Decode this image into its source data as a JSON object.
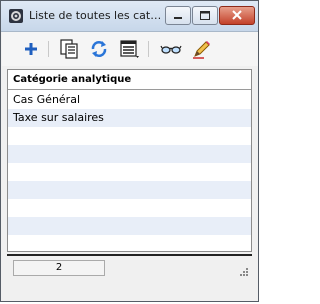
{
  "window": {
    "title": "Liste de toutes les cat…"
  },
  "toolbar": {
    "items": [
      {
        "name": "add-icon"
      },
      {
        "name": "copy-icon"
      },
      {
        "name": "refresh-icon"
      },
      {
        "name": "list-menu-icon"
      },
      {
        "name": "view-glasses-icon"
      },
      {
        "name": "edit-pencil-icon"
      }
    ]
  },
  "list": {
    "column_header": "Catégorie analytique",
    "rows": [
      "Cas Général",
      "Taxe sur salaires",
      "",
      "",
      "",
      "",
      "",
      "",
      ""
    ]
  },
  "status": {
    "count": "2"
  },
  "colors": {
    "accent_blue": "#1f5fbf",
    "row_alt": "#e8eef8"
  }
}
